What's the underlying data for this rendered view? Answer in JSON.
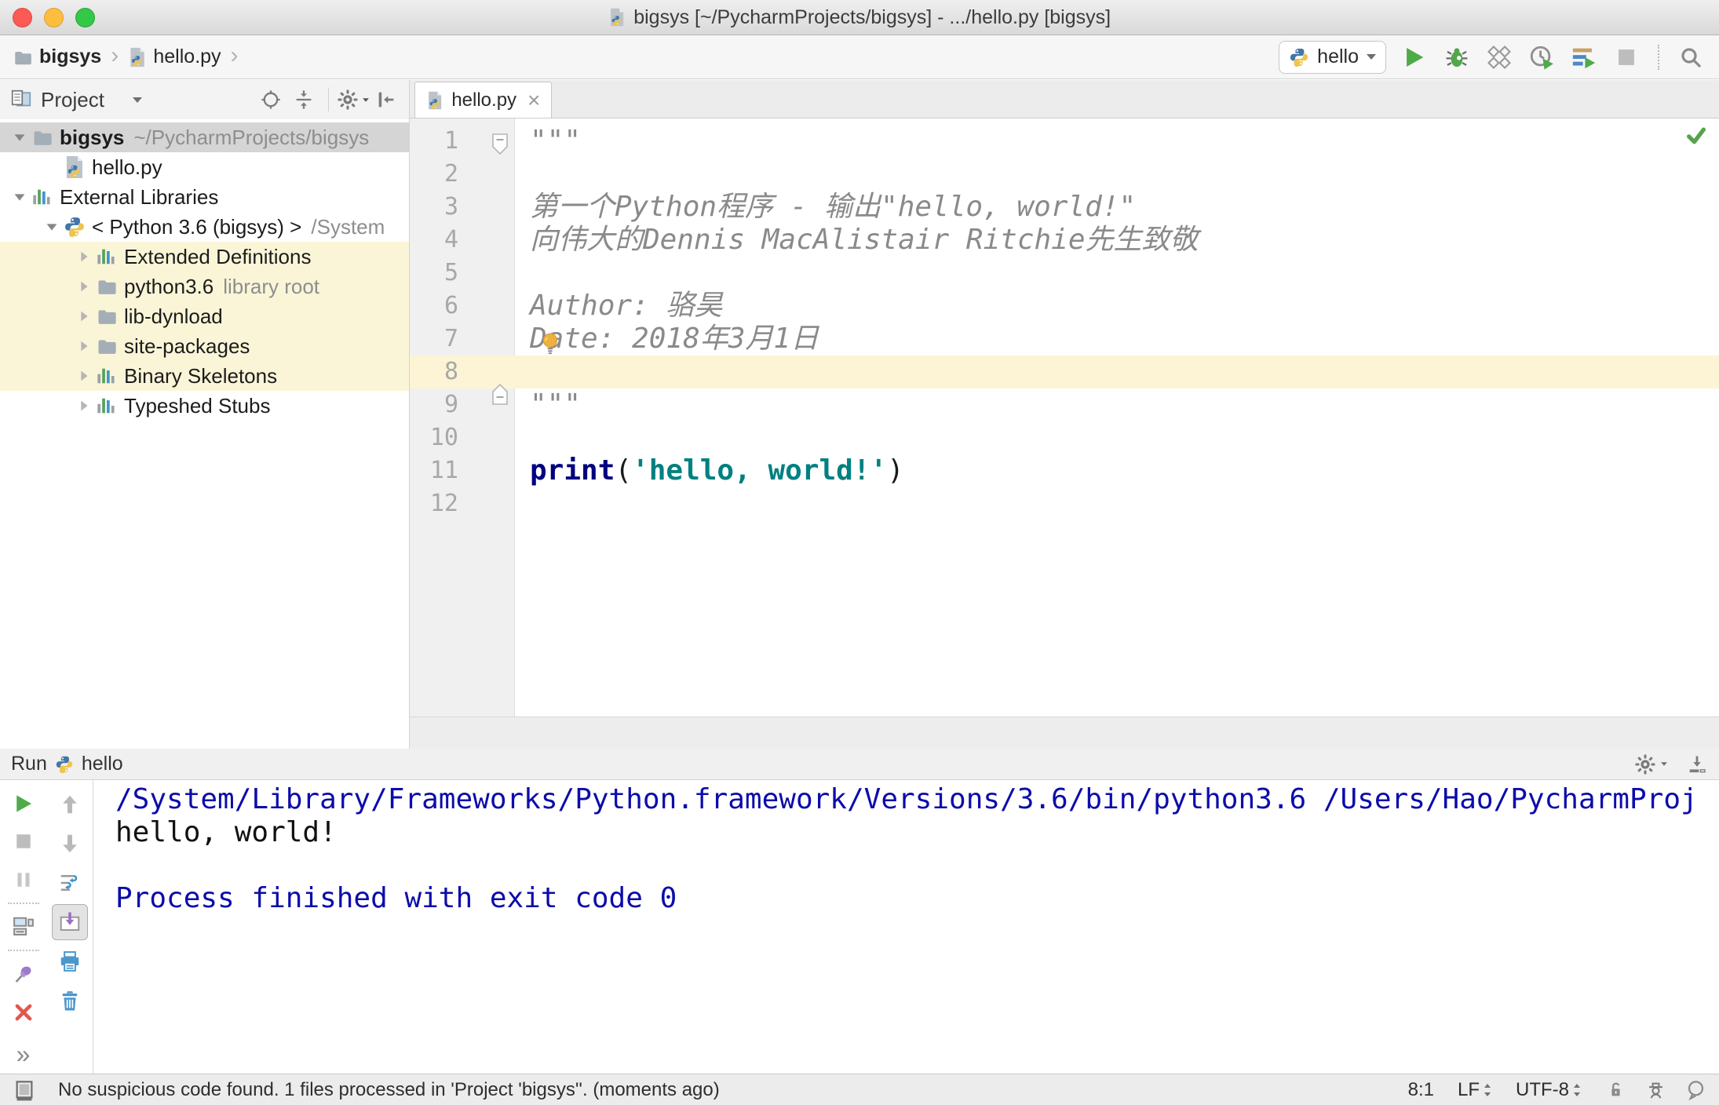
{
  "title_bar": {
    "title": "bigsys [~/PycharmProjects/bigsys] - .../hello.py [bigsys]"
  },
  "navbar": {
    "breadcrumbs": [
      {
        "icon": "folder",
        "label": "bigsys",
        "bold": true
      },
      {
        "icon": "python-file",
        "label": "hello.py",
        "bold": false
      }
    ],
    "run_config": {
      "icon": "python",
      "label": "hello"
    },
    "buttons": [
      {
        "name": "run-button",
        "icon": "run"
      },
      {
        "name": "debug-button",
        "icon": "debug"
      },
      {
        "name": "run-with-coverage-button",
        "icon": "coverage"
      },
      {
        "name": "profiler-button",
        "icon": "profiler"
      },
      {
        "name": "concurrency-diagram-button",
        "icon": "concurrency"
      },
      {
        "name": "stop-button",
        "icon": "stop"
      }
    ],
    "search_button": {
      "name": "search-everywhere-button",
      "icon": "search"
    }
  },
  "project_panel": {
    "title": "Project",
    "header_buttons": [
      {
        "name": "locate-button",
        "icon": "target"
      },
      {
        "name": "collapse-all-button",
        "icon": "collapse-all"
      },
      {
        "name": "separator"
      },
      {
        "name": "panel-settings-button",
        "icon": "gear",
        "dropdown": true
      },
      {
        "name": "hide-panel-button",
        "icon": "hide-left"
      }
    ],
    "tree": [
      {
        "label": "bigsys",
        "suffix": "~/PycharmProjects/bigsys",
        "icon": "folder",
        "arrow": "down",
        "indent": 0,
        "bold": true,
        "selected": true
      },
      {
        "label": "hello.py",
        "icon": "python-file",
        "arrow": null,
        "indent": 1
      },
      {
        "label": "External Libraries",
        "icon": "library",
        "arrow": "down",
        "indent": 0
      },
      {
        "label": "< Python 3.6 (bigsys) >",
        "suffix": "/System",
        "icon": "python",
        "arrow": "down",
        "indent": 1
      },
      {
        "label": "Extended Definitions",
        "icon": "library",
        "arrow": "right",
        "indent": 2,
        "highlight": true
      },
      {
        "label": "python3.6",
        "suffix": "library root",
        "icon": "folder",
        "arrow": "right",
        "indent": 2,
        "highlight": true
      },
      {
        "label": "lib-dynload",
        "icon": "folder",
        "arrow": "right",
        "indent": 2,
        "highlight": true
      },
      {
        "label": "site-packages",
        "icon": "folder",
        "arrow": "right",
        "indent": 2,
        "highlight": true
      },
      {
        "label": "Binary Skeletons",
        "icon": "library",
        "arrow": "right",
        "indent": 2,
        "highlight": true
      },
      {
        "label": "Typeshed Stubs",
        "icon": "library",
        "arrow": "right",
        "indent": 2
      }
    ]
  },
  "editor": {
    "tab": {
      "label": "hello.py",
      "icon": "python-file",
      "close": "×"
    },
    "current_line": 8,
    "caret_position": "8:1",
    "bulb_line": 7,
    "inspection": "ok",
    "fold_markers": [
      {
        "line": 1,
        "kind": "start"
      },
      {
        "line": 9,
        "kind": "end"
      }
    ],
    "lines": [
      {
        "num": 1,
        "tokens": [
          {
            "text": "\"\"\"",
            "style": "comment"
          }
        ]
      },
      {
        "num": 2,
        "tokens": []
      },
      {
        "num": 3,
        "tokens": [
          {
            "text": "第一个Python程序 - 输出\"hello, world!\"",
            "style": "comment"
          }
        ]
      },
      {
        "num": 4,
        "tokens": [
          {
            "text": "向伟大的Dennis MacAlistair Ritchie先生致敬",
            "style": "comment"
          }
        ]
      },
      {
        "num": 5,
        "tokens": []
      },
      {
        "num": 6,
        "tokens": [
          {
            "text": "Author: 骆昊",
            "style": "comment"
          }
        ]
      },
      {
        "num": 7,
        "tokens": [
          {
            "text": "Date: 2018年3月1日",
            "style": "comment"
          }
        ]
      },
      {
        "num": 8,
        "tokens": []
      },
      {
        "num": 9,
        "tokens": [
          {
            "text": "\"\"\"",
            "style": "comment"
          }
        ]
      },
      {
        "num": 10,
        "tokens": []
      },
      {
        "num": 11,
        "tokens": [
          {
            "text": "print",
            "style": "keyword"
          },
          {
            "text": "(",
            "style": "plain"
          },
          {
            "text": "'hello, world!'",
            "style": "string"
          },
          {
            "text": ")",
            "style": "plain"
          }
        ]
      },
      {
        "num": 12,
        "tokens": []
      }
    ]
  },
  "run_panel": {
    "label": "Run",
    "config": {
      "icon": "python",
      "label": "hello"
    },
    "header_buttons": [
      {
        "name": "run-settings-button",
        "icon": "gear",
        "dropdown": true
      },
      {
        "name": "hide-run-panel-button",
        "icon": "hide-down"
      }
    ],
    "toolbar_left": [
      {
        "name": "rerun-button",
        "icon": "run"
      },
      {
        "name": "stop-process-button",
        "icon": "stop"
      },
      {
        "name": "pause-output-button",
        "icon": "pause"
      },
      {
        "name": "separator"
      },
      {
        "name": "restore-layout-button",
        "icon": "layout"
      },
      {
        "name": "separator"
      },
      {
        "name": "pin-tab-button",
        "icon": "pin"
      },
      {
        "name": "close-tab-button",
        "icon": "close-red"
      },
      {
        "name": "more-options-button",
        "icon": "more",
        "glyph": "»"
      }
    ],
    "toolbar_right": [
      {
        "name": "up-the-stack-trace-button",
        "icon": "arrow-up"
      },
      {
        "name": "down-the-stack-trace-button",
        "icon": "arrow-down"
      },
      {
        "name": "soft-wrap-button",
        "icon": "softwrap"
      },
      {
        "name": "scroll-to-end-button",
        "icon": "scroll-end",
        "selected": true
      },
      {
        "name": "print-button",
        "icon": "printer"
      },
      {
        "name": "clear-all-button",
        "icon": "trash"
      }
    ],
    "console": [
      {
        "text": "/System/Library/Frameworks/Python.framework/Versions/3.6/bin/python3.6 /Users/Hao/PycharmProj",
        "kind": "system"
      },
      {
        "text": "hello, world!",
        "kind": "stdout"
      },
      {
        "text": "",
        "kind": "stdout"
      },
      {
        "text": "Process finished with exit code 0",
        "kind": "system"
      }
    ]
  },
  "status_bar": {
    "message": "No suspicious code found. 1 files processed in 'Project 'bigsys''. (moments ago)",
    "position": "8:1",
    "line_ending": "LF",
    "encoding": "UTF-8",
    "left_icon": "toolwindow",
    "right_icons": [
      {
        "name": "highlighting-level-lock",
        "icon": "lock"
      },
      {
        "name": "hector-inspector",
        "icon": "hector"
      },
      {
        "name": "feedback-bubble",
        "icon": "bubble"
      }
    ]
  },
  "colors": {
    "selection_gray": "#d5d5d5",
    "tree_highlight": "#fbf5d8",
    "current_line": "#fcf4d5",
    "keyword": "#000080",
    "string": "#008080",
    "comment": "#8a8a8a",
    "console_system": "#0c0cab",
    "run_green": "#4fab49",
    "titlebar_top": "#efefef",
    "status_bg": "#ececec"
  }
}
